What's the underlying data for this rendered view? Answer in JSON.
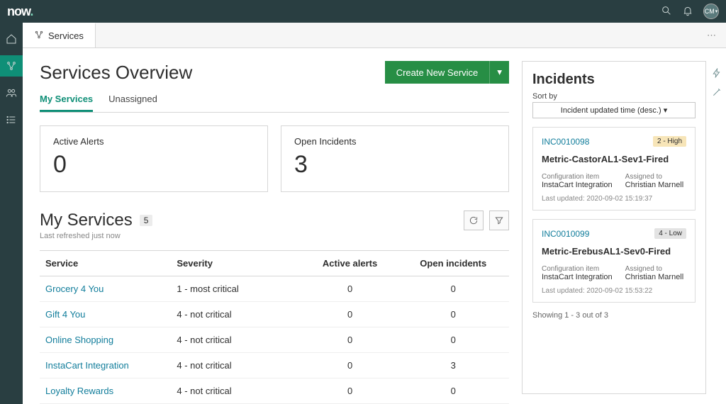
{
  "brand": "now",
  "avatar_initials": "CM",
  "work_tab": "Services",
  "header": {
    "title": "Services Overview",
    "create_btn": "Create New Service"
  },
  "subtabs": [
    {
      "label": "My Services",
      "active": true
    },
    {
      "label": "Unassigned",
      "active": false
    }
  ],
  "cards": {
    "active_alerts": {
      "label": "Active Alerts",
      "value": "0"
    },
    "open_incidents": {
      "label": "Open Incidents",
      "value": "3"
    }
  },
  "services": {
    "title": "My Services",
    "count": "5",
    "refreshed": "Last refreshed just now",
    "columns": {
      "service": "Service",
      "severity": "Severity",
      "active_alerts": "Active alerts",
      "open_incidents": "Open incidents"
    },
    "rows": [
      {
        "service": "Grocery 4 You",
        "severity": "1 - most critical",
        "active_alerts": "0",
        "open_incidents": "0"
      },
      {
        "service": "Gift 4 You",
        "severity": "4 - not critical",
        "active_alerts": "0",
        "open_incidents": "0"
      },
      {
        "service": "Online Shopping",
        "severity": "4 - not critical",
        "active_alerts": "0",
        "open_incidents": "0"
      },
      {
        "service": "InstaCart Integration",
        "severity": "4 - not critical",
        "active_alerts": "0",
        "open_incidents": "3"
      },
      {
        "service": "Loyalty Rewards",
        "severity": "4 - not critical",
        "active_alerts": "0",
        "open_incidents": "0"
      }
    ]
  },
  "incidents": {
    "title": "Incidents",
    "sort_label": "Sort by",
    "sort_value": "Incident updated time (desc.) ▾",
    "meta_labels": {
      "ci": "Configuration item",
      "assigned": "Assigned to"
    },
    "items": [
      {
        "id": "INC0010098",
        "priority": "2 - High",
        "priority_class": "high",
        "title": "Metric-CastorAL1-Sev1-Fired",
        "ci": "InstaCart Integration",
        "assigned": "Christian Marnell",
        "updated": "Last updated: 2020-09-02 15:19:37"
      },
      {
        "id": "INC0010099",
        "priority": "4 - Low",
        "priority_class": "low",
        "title": "Metric-ErebusAL1-Sev0-Fired",
        "ci": "InstaCart Integration",
        "assigned": "Christian Marnell",
        "updated": "Last updated: 2020-09-02 15:53:22"
      }
    ],
    "showing": "Showing 1 - 3 out of 3"
  }
}
